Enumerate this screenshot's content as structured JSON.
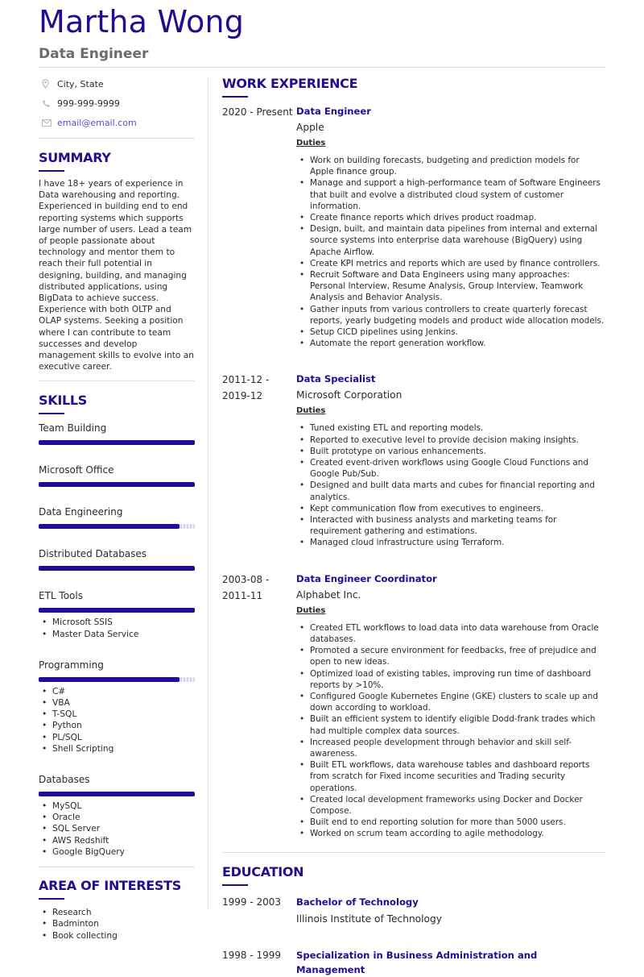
{
  "header": {
    "name": "Martha Wong",
    "title": "Data Engineer"
  },
  "colors": {
    "accent": "#1f0e8f",
    "email": "#5a4fc2",
    "rule": "#dedede"
  },
  "contact": {
    "location": {
      "icon": "map-pin-icon",
      "text": "City, State"
    },
    "phone": {
      "icon": "phone-icon",
      "text": "999-999-9999"
    },
    "email": {
      "icon": "envelope-icon",
      "text": "email@email.com"
    }
  },
  "summary": {
    "heading": "SUMMARY",
    "text": "I have 18+ years of experience in Data warehousing and reporting. Experienced in building end to end reporting systems which supports large number of users. Lead a team of people passionate about technology and mentor them to reach their full potential in designing, building, and managing distributed applications, using BigData to achieve success. Experience with both OLTP and OLAP systems. Seeking a position where I can contribute to team successes and develop management skills to evolve into an executive career."
  },
  "skills": {
    "heading": "SKILLS",
    "items": [
      {
        "name": "Team Building",
        "level": 1.0,
        "list": []
      },
      {
        "name": "Microsoft Office",
        "level": 1.0,
        "list": []
      },
      {
        "name": "Data Engineering",
        "level": 0.9,
        "list": []
      },
      {
        "name": "Distributed Databases",
        "level": 1.0,
        "list": []
      },
      {
        "name": "ETL Tools",
        "level": 1.0,
        "list": [
          "Microsoft SSIS",
          "Master Data Service"
        ]
      },
      {
        "name": "Programming",
        "level": 0.9,
        "list": [
          "C#",
          "VBA",
          "T-SQL",
          "Python",
          "PL/SQL",
          "Shell Scripting"
        ]
      },
      {
        "name": "Databases",
        "level": 1.0,
        "list": [
          "MySQL",
          "Oracle",
          "SQL Server",
          "AWS Redshift",
          "Google BigQuery"
        ]
      }
    ]
  },
  "interests": {
    "heading": "AREA OF INTERESTS",
    "items": [
      "Research",
      "Badminton",
      "Book collecting"
    ]
  },
  "work": {
    "heading": "WORK EXPERIENCE",
    "duties_label": "Duties",
    "jobs": [
      {
        "date": "2020 - Present",
        "title": "Data Engineer",
        "company": "Apple",
        "duties": [
          "Work on building forecasts, budgeting and prediction models for Apple finance group.",
          "Manage and support a high-performance team of Software Engineers that built and evolve a distributed cloud system of customer information.",
          "Create finance reports which drives product roadmap.",
          "Design, built, and maintain data pipelines from internal and external source systems into enterprise data warehouse (BigQuery) using Apache Airflow.",
          "Create KPI metrics and reports which are used by finance controllers.",
          "Recruit Software and Data Engineers using many approaches: Personal Interview, Resume Analysis, Group Interview, Teamwork Analysis and Behavior Analysis.",
          "Gather inputs from various controllers to create quarterly forecast reports, yearly budgeting models and product wide allocation models.",
          "Setup CICD pipelines using Jenkins.",
          "Automate the report generation workflow."
        ]
      },
      {
        "date": "2011-12 - 2019-12",
        "title": "Data Specialist",
        "company": "Microsoft Corporation",
        "duties": [
          "Tuned existing ETL and reporting models.",
          "Reported to executive level to provide decision making insights.",
          "Built prototype on various enhancements.",
          "Created event-driven workflows using Google Cloud Functions and Google Pub/Sub.",
          "Designed and built data marts and cubes for financial reporting and analytics.",
          "Kept communication flow from executives to engineers.",
          "Interacted with business analysts and marketing teams for requirement gathering and estimations.",
          "Managed cloud infrastructure using Terraform."
        ]
      },
      {
        "date": "2003-08 - 2011-11",
        "title": "Data Engineer Coordinator",
        "company": "Alphabet Inc.",
        "duties": [
          "Created ETL workflows to load data into data warehouse from Oracle databases.",
          "Promoted a secure environment for feedbacks, free of prejudice and open to new ideas.",
          "Optimized load of existing tables, improving run time of dashboard reports by >10%.",
          "Configured Google Kubernetes Engine (GKE) clusters to scale up and down according to workload.",
          "Built an efficient system to identify eligible Dodd-frank trades which had multiple complex data sources.",
          "Increased people development through behavior and skill self-awareness.",
          "Built ETL workflows, data warehouse tables and dashboard reports from scratch for Fixed income securities and Trading security operations.",
          "Created local development frameworks using Docker and Docker Compose.",
          "Built end to end reporting solution for more than 5000 users.",
          "Worked on scrum team according to agile methodology."
        ]
      }
    ]
  },
  "education": {
    "heading": "EDUCATION",
    "items": [
      {
        "date": "1999 - 2003",
        "degree": "Bachelor of Technology",
        "school": "Illinois Institute of Technology"
      },
      {
        "date": "1998 - 1999",
        "degree": "Specialization in Business Administration and Management",
        "school": ""
      }
    ]
  }
}
